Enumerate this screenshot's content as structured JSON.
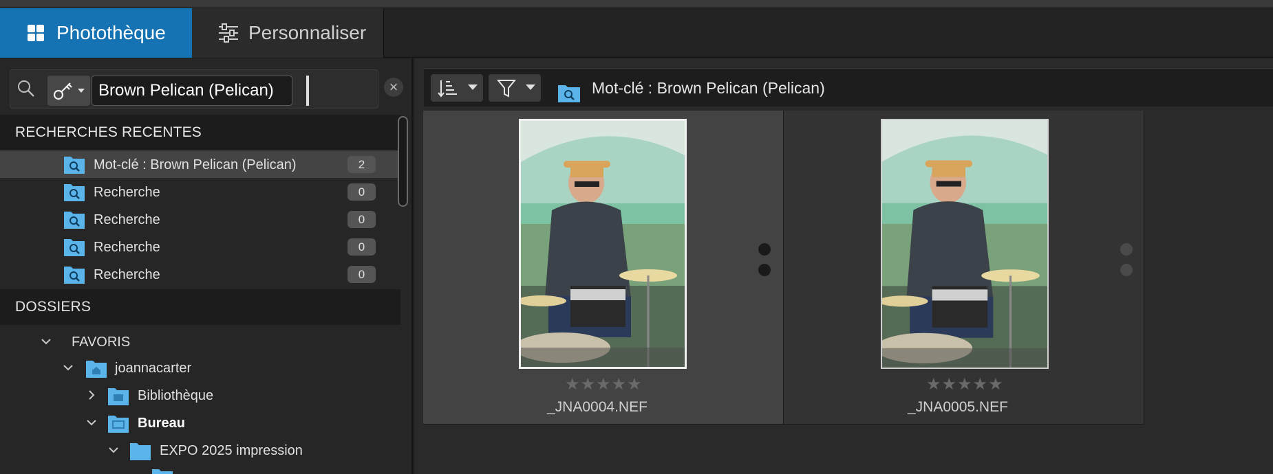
{
  "tabs": {
    "library_label": "Photothèque",
    "customize_label": "Personnaliser"
  },
  "search": {
    "keyword_value": "Brown Pelican (Pelican)"
  },
  "recent": {
    "title": "RECHERCHES RECENTES",
    "items": [
      {
        "label": "Mot-clé : Brown Pelican (Pelican)",
        "count": "2"
      },
      {
        "label": "Recherche",
        "count": "0"
      },
      {
        "label": "Recherche",
        "count": "0"
      },
      {
        "label": "Recherche",
        "count": "0"
      },
      {
        "label": "Recherche",
        "count": "0"
      }
    ]
  },
  "folders": {
    "title": "DOSSIERS",
    "tree": [
      {
        "label": "FAVORIS"
      },
      {
        "label": "joannacarter"
      },
      {
        "label": "Bibliothèque"
      },
      {
        "label": "Bureau"
      },
      {
        "label": "EXPO 2025 impression"
      }
    ]
  },
  "browser": {
    "breadcrumb": "Mot-clé : Brown Pelican (Pelican)",
    "images": [
      {
        "filename": "_JNA0004.NEF",
        "stars": "★★★★★",
        "rating": 0
      },
      {
        "filename": "_JNA0005.NEF",
        "stars": "★★★★★",
        "rating": 0
      }
    ]
  },
  "colors": {
    "accent": "#1673b3",
    "folder_blue": "#5ab4ea"
  }
}
